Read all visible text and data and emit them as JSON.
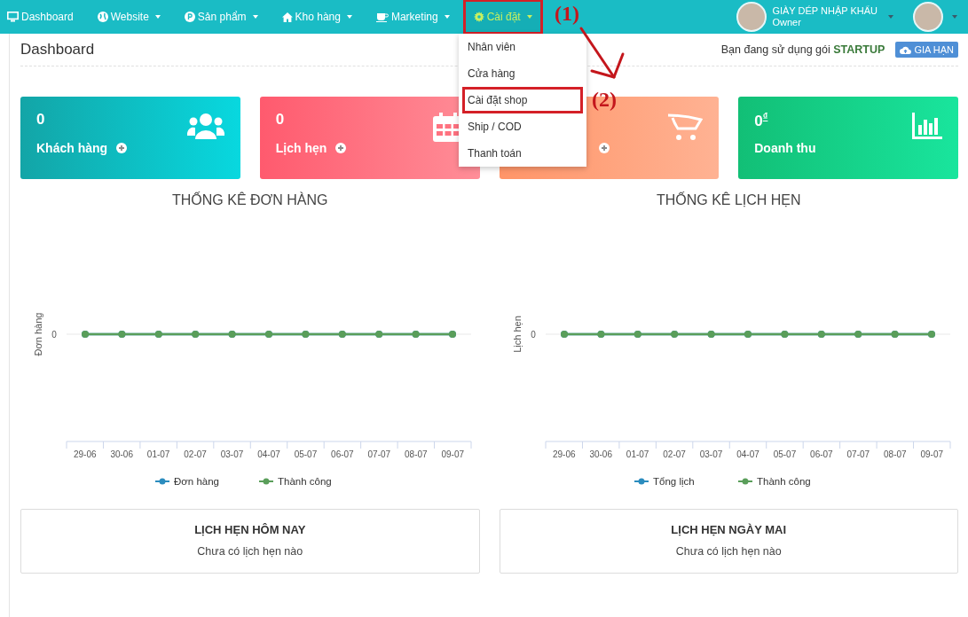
{
  "navbar": {
    "items": [
      {
        "label": "Dashboard",
        "has_menu": false,
        "selected": false,
        "annotated": false
      },
      {
        "label": "Website",
        "has_menu": true,
        "selected": false,
        "annotated": false
      },
      {
        "label": "Sản phẩm",
        "has_menu": true,
        "selected": false,
        "annotated": false
      },
      {
        "label": "Kho hàng",
        "has_menu": true,
        "selected": false,
        "annotated": false
      },
      {
        "label": "Marketing",
        "has_menu": true,
        "selected": false,
        "annotated": false
      },
      {
        "label": "Cài đặt",
        "has_menu": true,
        "selected": true,
        "annotated": true
      }
    ],
    "account": {
      "name": "GIÀY DÉP NHẬP KHẨU",
      "role": "Owner"
    }
  },
  "settings_menu": {
    "items": [
      {
        "label": "Nhân viên",
        "annotated": false
      },
      {
        "label": "Cửa hàng",
        "annotated": false
      },
      {
        "label": "Cài đặt shop",
        "annotated": true
      },
      {
        "label": "Ship / COD",
        "annotated": false
      },
      {
        "label": "Thanh toán",
        "annotated": false
      }
    ]
  },
  "annotations": [
    {
      "label": "(1)"
    },
    {
      "label": "(2)"
    }
  ],
  "header": {
    "title": "Dashboard",
    "plan_text": "Bạn đang sử dụng gói **STARTUP**",
    "renew_button": "GIA HẠN"
  },
  "stats": [
    {
      "value": "0",
      "label": "Khách hàng"
    },
    {
      "value": "0",
      "label": "Lịch hẹn"
    },
    {
      "covered": true
    },
    {
      "value": "0$^{₫}$",
      "label": "Doanh thu"
    }
  ],
  "charts": [
    {
      "title": "THỐNG KÊ ĐƠN HÀNG",
      "y_axis_label": "Đơn hàng",
      "y_tick_label": "0",
      "x_labels": [
        "29-06",
        "30-06",
        "01-07",
        "02-07",
        "03-07",
        "04-07",
        "05-07",
        "06-07",
        "07-07",
        "08-07",
        "09-07"
      ],
      "legend": [
        {
          "name": "Đơn hàng",
          "color": "#2b8cbe"
        },
        {
          "name": "Thành công",
          "color": "#5a9e5a"
        }
      ]
    },
    {
      "title": "THỐNG KÊ LỊCH HẸN",
      "y_axis_label": "Lịch hẹn",
      "y_tick_label": "0",
      "x_labels": [
        "29-06",
        "30-06",
        "01-07",
        "02-07",
        "03-07",
        "04-07",
        "05-07",
        "06-07",
        "07-07",
        "08-07",
        "09-07"
      ],
      "legend": [
        {
          "name": "Tổng lịch",
          "color": "#2b8cbe"
        },
        {
          "name": "Thành công",
          "color": "#5a9e5a"
        }
      ]
    }
  ],
  "appointment_cards": [
    {
      "title": "LỊCH HẸN HÔM NAY",
      "message": "Chưa có lịch hẹn nào"
    },
    {
      "title": "LỊCH HẸN NGÀY MAI",
      "message": "Chưa có lịch hẹn nào"
    }
  ]
}
